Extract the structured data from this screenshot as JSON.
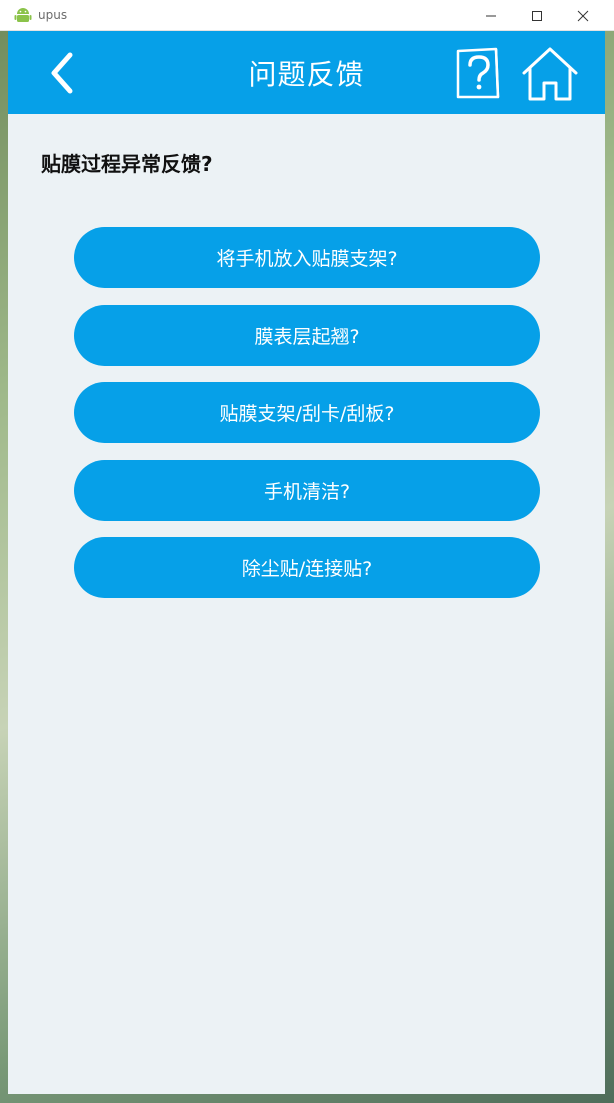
{
  "window": {
    "title": "upus"
  },
  "header": {
    "title": "问题反馈",
    "back_icon": "chevron-left-icon",
    "help_icon": "question-card-icon",
    "home_icon": "home-icon"
  },
  "section": {
    "title": "贴膜过程异常反馈?"
  },
  "options": [
    {
      "label": "将手机放入贴膜支架?"
    },
    {
      "label": "膜表层起翘?"
    },
    {
      "label": "贴膜支架/刮卡/刮板?"
    },
    {
      "label": "手机清洁?"
    },
    {
      "label": "除尘贴/连接贴?"
    }
  ],
  "colors": {
    "accent": "#06a0e8",
    "background": "#ecf2f5",
    "text_dark": "#111111",
    "text_light": "#ffffff"
  }
}
